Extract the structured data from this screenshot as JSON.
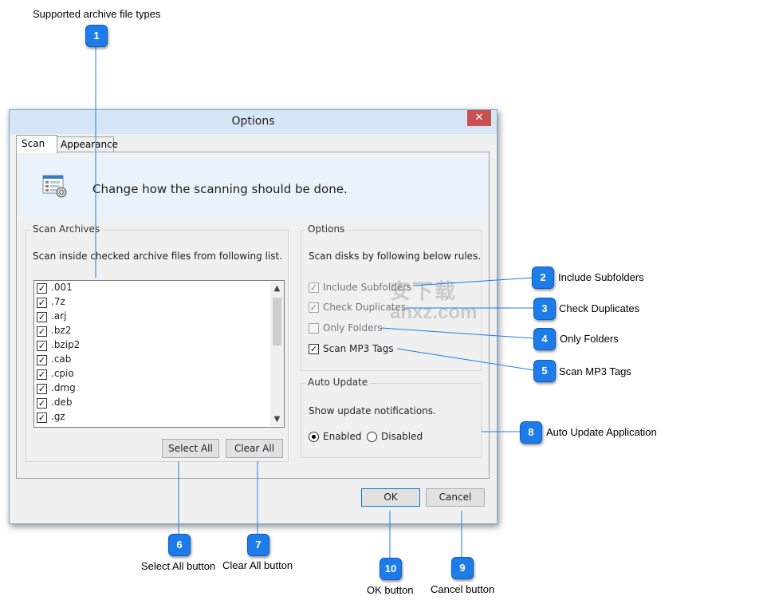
{
  "annotations": {
    "archive_types": "Supported archive file types",
    "include_subfolders": "Include Subfolders",
    "check_duplicates": "Check Duplicates",
    "only_folders": "Only Folders",
    "scan_mp3_tags": "Scan MP3 Tags",
    "auto_update": "Auto Update Application",
    "select_all": "Select All button",
    "clear_all": "Clear All button",
    "ok": "OK button",
    "cancel": "Cancel button"
  },
  "badges": [
    "1",
    "2",
    "3",
    "4",
    "5",
    "6",
    "7",
    "8",
    "9",
    "10"
  ],
  "window": {
    "title": "Options",
    "close_glyph": "✕"
  },
  "tabs": [
    "Scan",
    "Appearance"
  ],
  "banner": {
    "text": "Change how the scanning should be done.",
    "icon": "settings-list-icon"
  },
  "scan_archives": {
    "title": "Scan Archives",
    "description": "Scan inside checked archive files from following list.",
    "items": [
      {
        "label": ".001",
        "checked": true
      },
      {
        "label": ".7z",
        "checked": true
      },
      {
        "label": ".arj",
        "checked": true
      },
      {
        "label": ".bz2",
        "checked": true
      },
      {
        "label": ".bzip2",
        "checked": true
      },
      {
        "label": ".cab",
        "checked": true
      },
      {
        "label": ".cpio",
        "checked": true
      },
      {
        "label": ".dmg",
        "checked": true
      },
      {
        "label": ".deb",
        "checked": true
      },
      {
        "label": ".gz",
        "checked": true
      }
    ],
    "select_all": "Select All",
    "clear_all": "Clear All"
  },
  "options": {
    "title": "Options",
    "description": "Scan disks by following below rules.",
    "items": [
      {
        "label": "Include Subfolders",
        "checked": true,
        "disabled": true
      },
      {
        "label": "Check Duplicates",
        "checked": true,
        "disabled": true
      },
      {
        "label": "Only Folders",
        "checked": false,
        "disabled": true
      },
      {
        "label": "Scan MP3 Tags",
        "checked": true,
        "disabled": false
      }
    ]
  },
  "auto_update": {
    "title": "Auto Update",
    "description": "Show update notifications.",
    "enabled": "Enabled",
    "disabled": "Disabled",
    "selected": "Enabled"
  },
  "footer": {
    "ok": "OK",
    "cancel": "Cancel"
  },
  "watermark": {
    "top": "安下载",
    "bottom": "anxz.com"
  },
  "colors": {
    "badge": "#1e7ce8",
    "lines": "#1e7ce8",
    "banner": "#eaf3fc",
    "close": "#c75050"
  }
}
